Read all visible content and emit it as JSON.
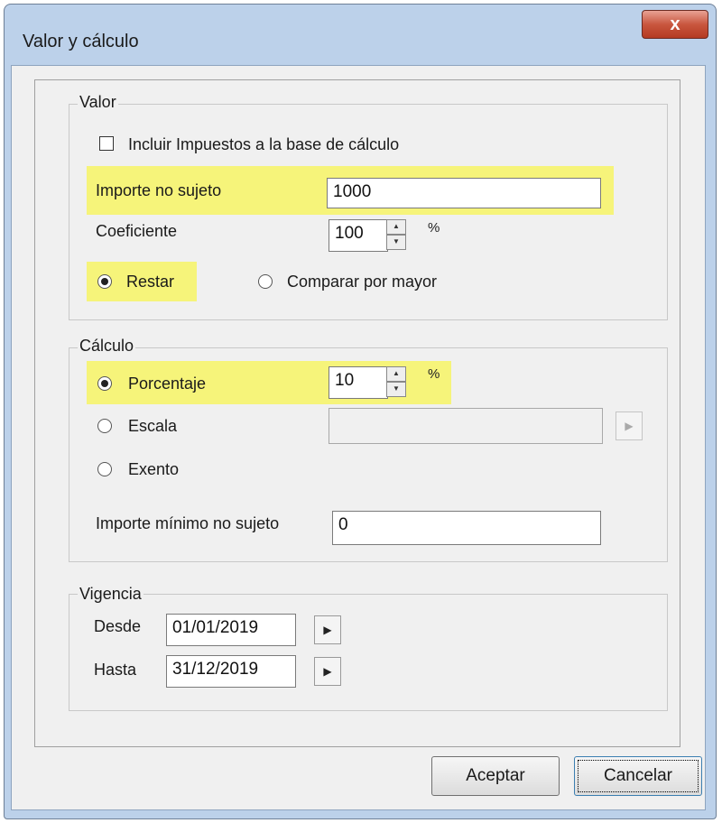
{
  "window": {
    "title": "Valor y cálculo",
    "close_label": "x"
  },
  "valor": {
    "legend": "Valor",
    "include_taxes_label": "Incluir Impuestos a la base de cálculo",
    "importe_no_sujeto_label": "Importe no sujeto",
    "importe_no_sujeto_value": "1000",
    "coeficiente_label": "Coeficiente",
    "coeficiente_value": "100",
    "coeficiente_unit": "%",
    "radio_restar": "Restar",
    "radio_comparar": "Comparar por mayor"
  },
  "calculo": {
    "legend": "Cálculo",
    "radio_porcentaje": "Porcentaje",
    "porcentaje_value": "10",
    "porcentaje_unit": "%",
    "radio_escala": "Escala",
    "escala_value": "",
    "radio_exento": "Exento",
    "importe_minimo_label": "Importe mínimo no sujeto",
    "importe_minimo_value": "0"
  },
  "vigencia": {
    "legend": "Vigencia",
    "desde_label": "Desde",
    "desde_value": "01/01/2019",
    "hasta_label": "Hasta",
    "hasta_value": "31/12/2019"
  },
  "buttons": {
    "ok": "Aceptar",
    "cancel": "Cancelar"
  },
  "colors": {
    "highlight": "#f6f47a",
    "frame": "#bcd1ea",
    "close": "#c9573f"
  }
}
